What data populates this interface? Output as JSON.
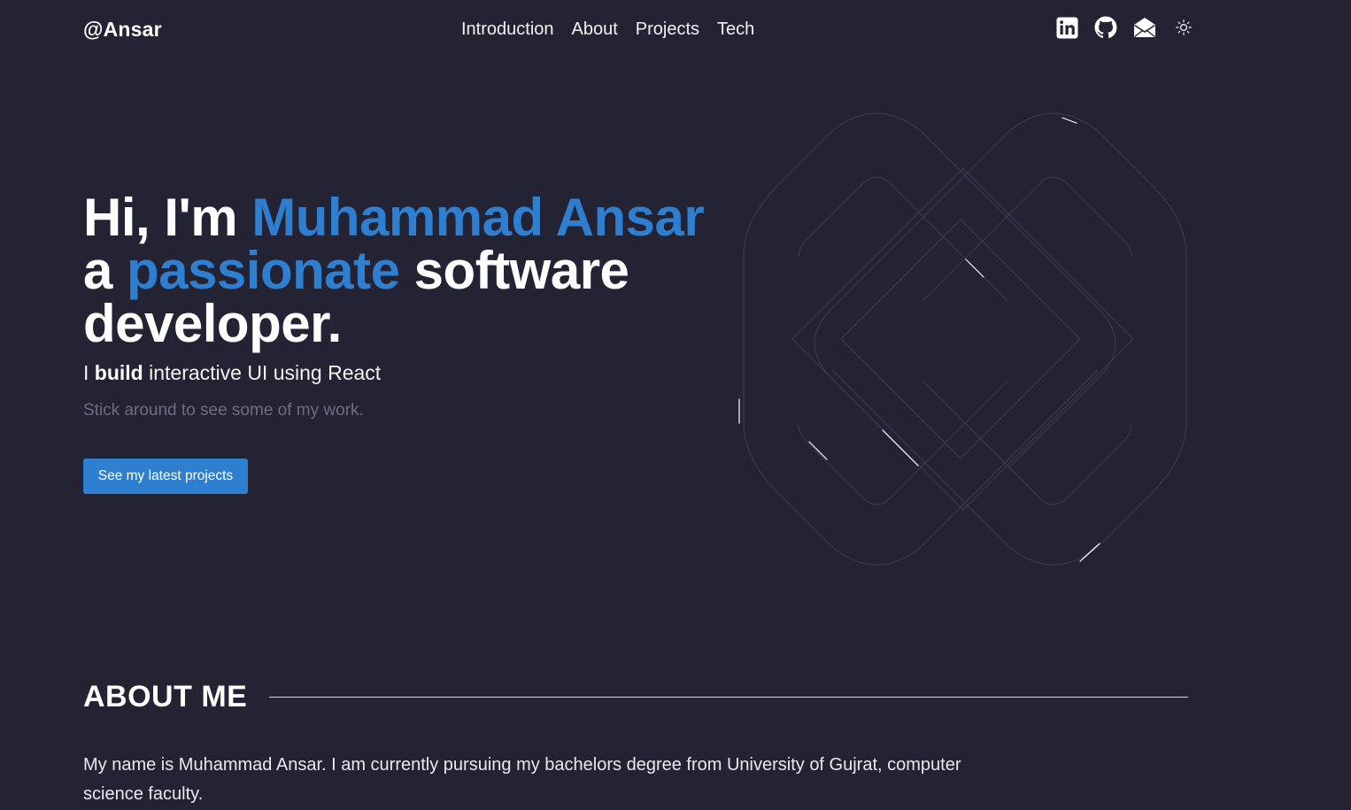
{
  "brand": "@Ansar",
  "nav": [
    {
      "label": "Introduction"
    },
    {
      "label": "About"
    },
    {
      "label": "Projects"
    },
    {
      "label": "Tech"
    }
  ],
  "socials": [
    "linkedin-icon",
    "github-icon",
    "mail-icon",
    "sun-icon"
  ],
  "hero": {
    "line1_plain": "Hi, I'm ",
    "line1_highlight": "Muhammad Ansar",
    "line2_plain_a": "a ",
    "line2_highlight": "passionate",
    "line2_plain_b": " software",
    "line3": "developer.",
    "sub_a": "I ",
    "sub_bold": "build",
    "sub_b": " interactive UI using React",
    "note": "Stick around to see some of my work.",
    "cta_label": "See my latest projects"
  },
  "about": {
    "title": "ABOUT ME",
    "text": "My name is Muhammad Ansar. I am currently pursuing my bachelors degree from University of Gujrat, computer science faculty."
  },
  "colors": {
    "background": "#242333",
    "accent": "#2f7fd0",
    "muted": "#6e6d82"
  }
}
